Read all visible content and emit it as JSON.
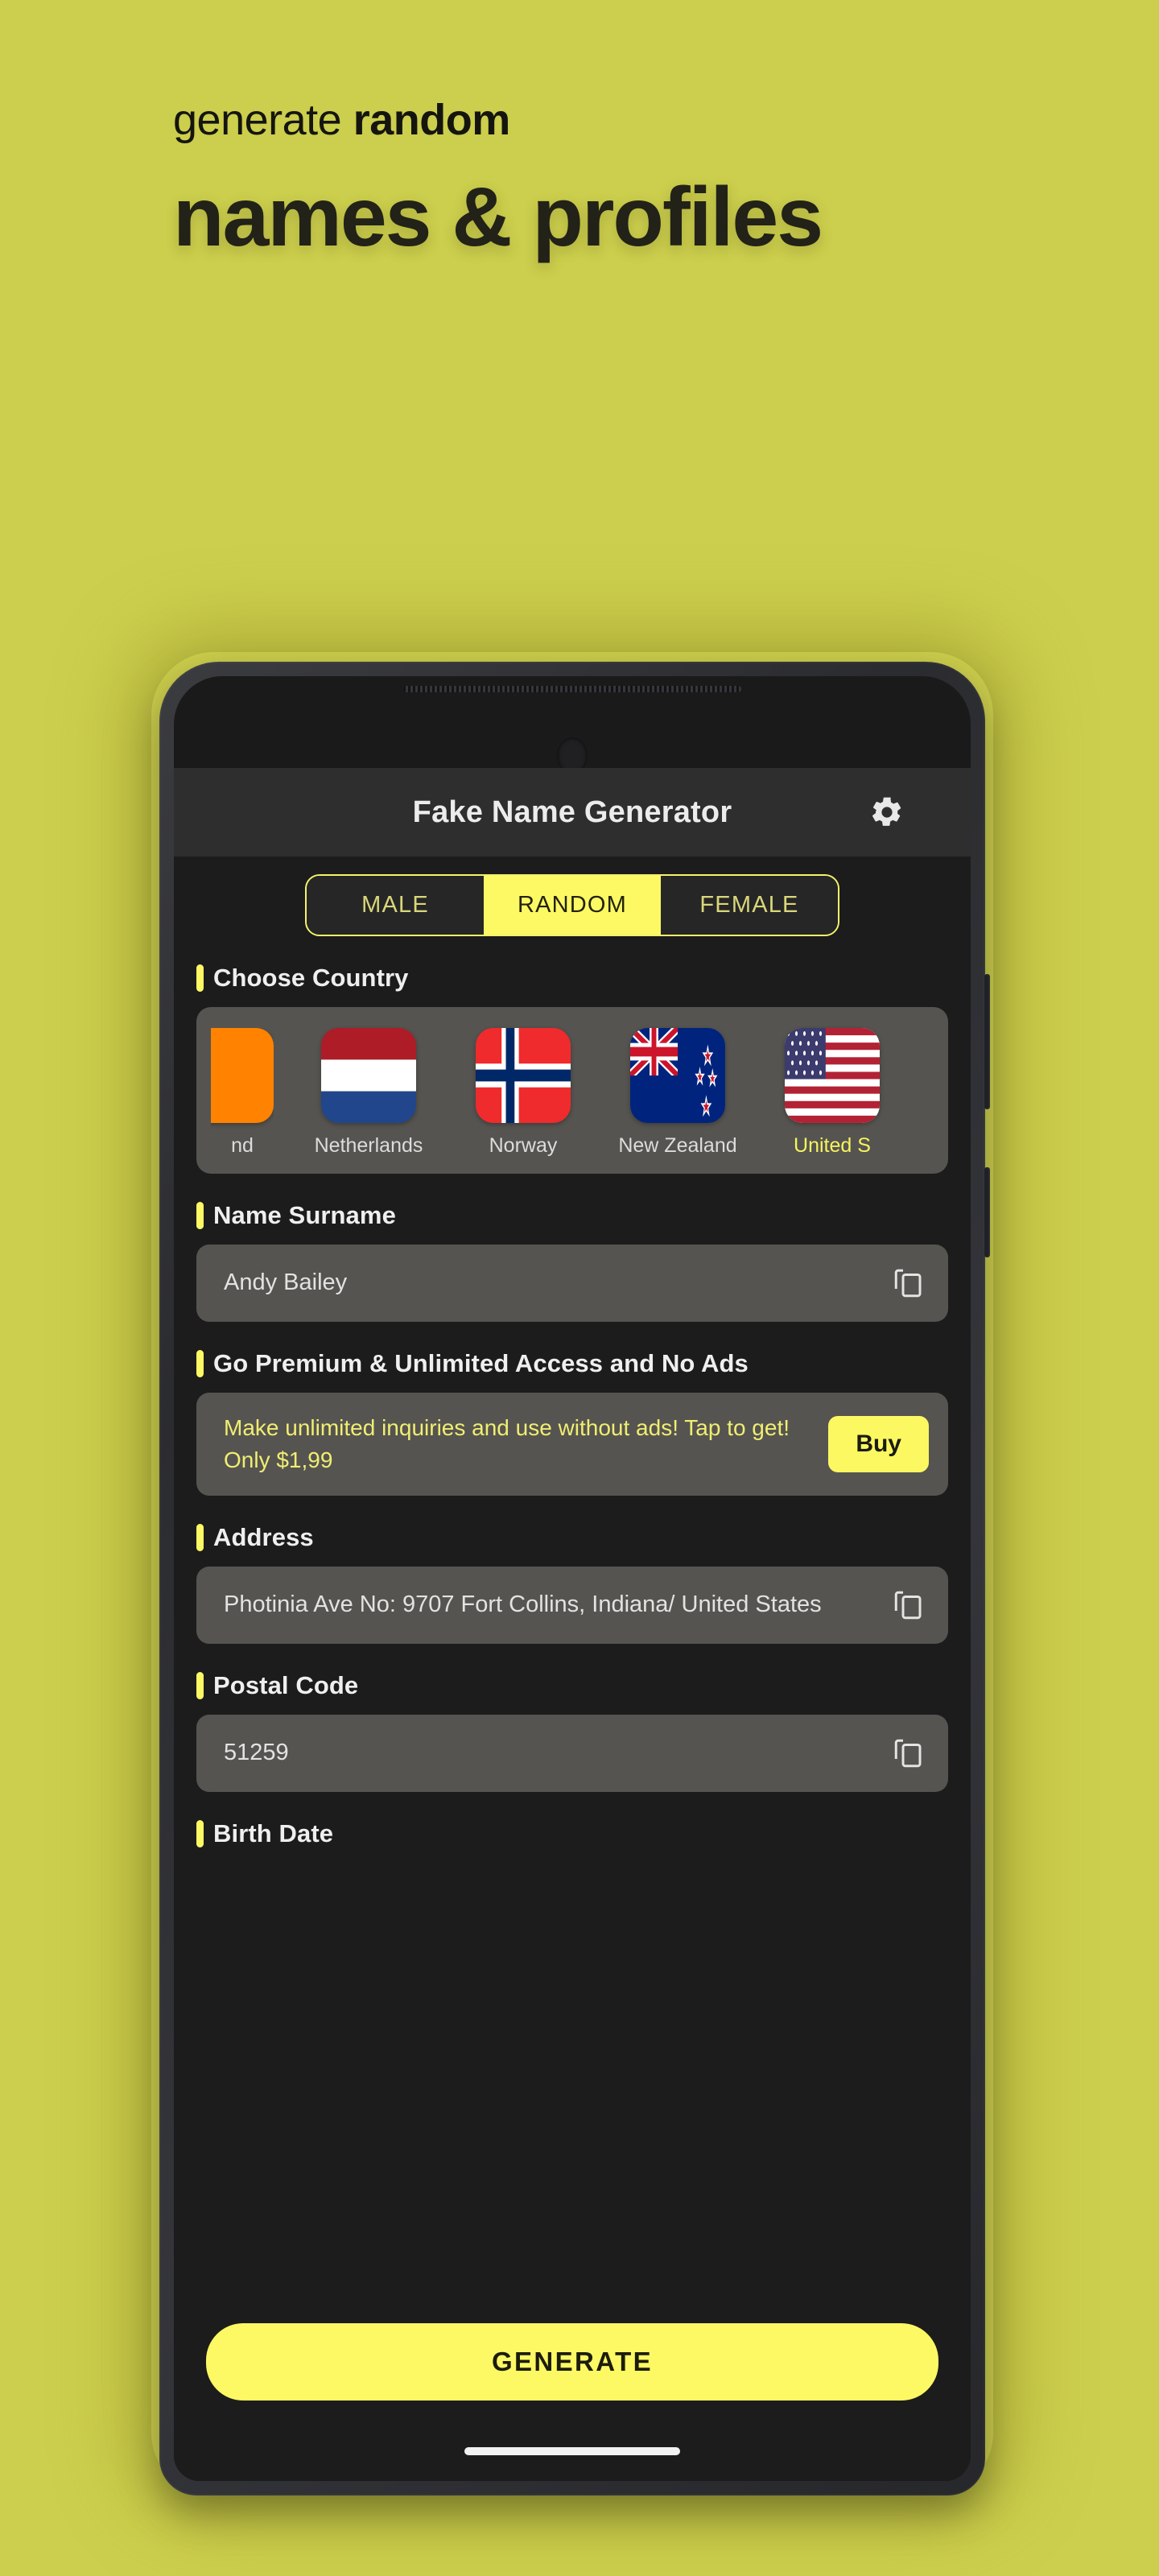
{
  "promo": {
    "line1_regular": "generate ",
    "line1_bold": "random",
    "title": "names & profiles",
    "background_color": "#CCCE4D",
    "text_color": "#222218"
  },
  "app": {
    "title": "Fake Name Generator",
    "accent_color": "#FCF964",
    "settings_icon": "gear-icon",
    "gender_tabs": [
      {
        "label": "MALE",
        "selected": false
      },
      {
        "label": "RANDOM",
        "selected": true
      },
      {
        "label": "FEMALE",
        "selected": false
      }
    ],
    "sections": {
      "country": {
        "label": "Choose Country",
        "items": [
          {
            "name": "nd",
            "flag": "ireland-flag",
            "selected": false,
            "clipped": true
          },
          {
            "name": "Netherlands",
            "flag": "netherlands-flag",
            "selected": false,
            "clipped": false
          },
          {
            "name": "Norway",
            "flag": "norway-flag",
            "selected": false,
            "clipped": false
          },
          {
            "name": "New Zealand",
            "flag": "new-zealand-flag",
            "selected": false,
            "clipped": false
          },
          {
            "name": "United S",
            "flag": "united-states-flag",
            "selected": true,
            "clipped": false
          }
        ]
      },
      "name": {
        "label": "Name Surname",
        "value": "Andy Bailey",
        "copy_icon": "copy-icon"
      },
      "premium": {
        "label": "Go Premium & Unlimited Access and No Ads",
        "text": "Make unlimited inquiries and use without ads! Tap to get! Only $1,99",
        "buy_label": "Buy"
      },
      "address": {
        "label": "Address",
        "value": "Photinia Ave No: 9707 Fort Collins, Indiana/ United States",
        "copy_icon": "copy-icon"
      },
      "postal": {
        "label": "Postal Code",
        "value": "51259",
        "copy_icon": "copy-icon"
      },
      "birth": {
        "label": "Birth Date"
      }
    },
    "generate_label": "GENERATE"
  }
}
